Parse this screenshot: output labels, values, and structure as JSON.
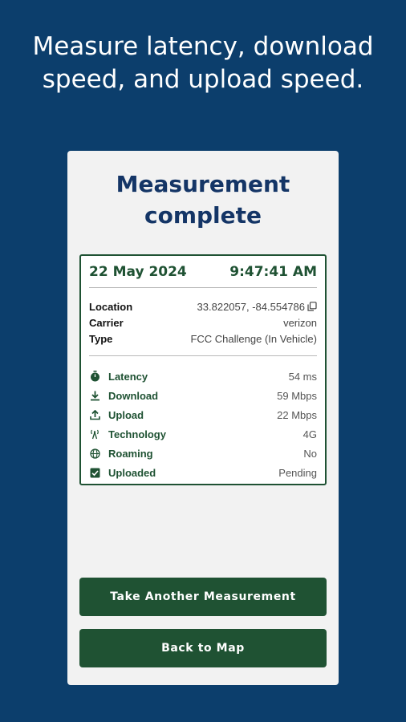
{
  "headline": "Measure latency, download speed, and upload speed.",
  "card": {
    "title": "Measurement complete",
    "date": "22 May 2024",
    "time": "9:47:41 AM",
    "info": [
      {
        "label": "Location",
        "value": "33.822057, -84.554786"
      },
      {
        "label": "Carrier",
        "value": "verizon"
      },
      {
        "label": "Type",
        "value": "FCC Challenge (In Vehicle)"
      }
    ],
    "metrics": [
      {
        "icon": "stopwatch-icon",
        "label": "Latency",
        "value": "54 ms"
      },
      {
        "icon": "download-icon",
        "label": "Download",
        "value": "59 Mbps"
      },
      {
        "icon": "upload-icon",
        "label": "Upload",
        "value": "22 Mbps"
      },
      {
        "icon": "cell-tower-icon",
        "label": "Technology",
        "value": "4G"
      },
      {
        "icon": "globe-icon",
        "label": "Roaming",
        "value": "No"
      },
      {
        "icon": "checkbox-icon",
        "label": "Uploaded",
        "value": "Pending"
      }
    ]
  },
  "buttons": {
    "take_another": "Take Another Measurement",
    "back_to_map": "Back to Map"
  },
  "colors": {
    "background": "#0c3e6c",
    "card": "#f2f2f2",
    "title": "#143566",
    "accent_green": "#1f5233"
  }
}
